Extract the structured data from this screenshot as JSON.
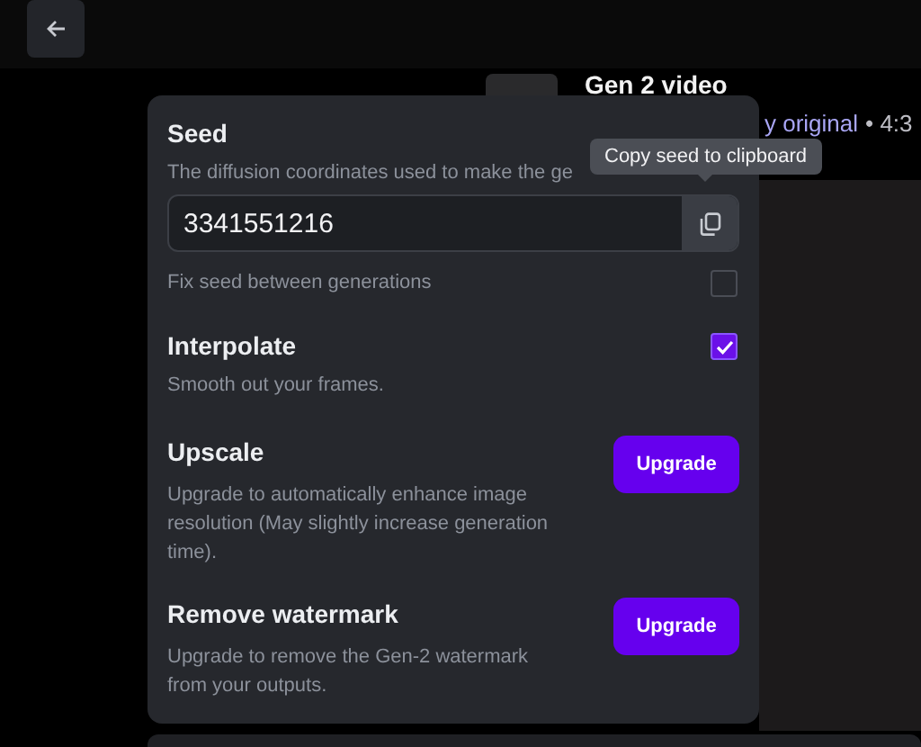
{
  "page": {
    "title": "Gen 2 video",
    "link": "y original",
    "meta": "• 4:3"
  },
  "seed": {
    "title": "Seed",
    "description": "The diffusion coordinates used to make the ge",
    "value": "3341551216",
    "copy_tooltip": "Copy seed to clipboard",
    "fix_label": "Fix seed between generations",
    "fix_checked": false
  },
  "options": [
    {
      "kind": "toggle",
      "title": "Interpolate",
      "description": "Smooth out your frames.",
      "checked": true
    },
    {
      "kind": "upgrade",
      "title": "Upscale",
      "description": "Upgrade to automatically enhance image resolution (May slightly increase generation time).",
      "button": "Upgrade"
    },
    {
      "kind": "upgrade",
      "title": "Remove watermark",
      "description": "Upgrade to remove the Gen-2 watermark from your outputs.",
      "button": "Upgrade"
    }
  ]
}
